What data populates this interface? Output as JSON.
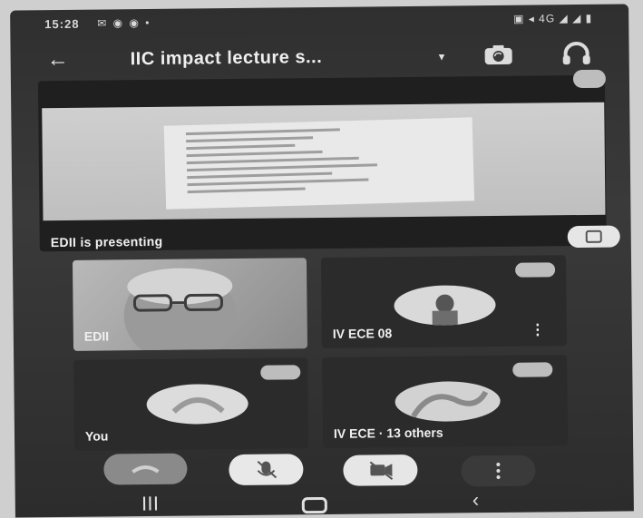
{
  "status_bar": {
    "time": "15:28",
    "left_icons": "✉ ◉ ◉ •",
    "right_icons": "▣ ◂ 4G ◢ ◢ ▮"
  },
  "top_bar": {
    "title": "IIC impact lecture s...",
    "chevron": "▾"
  },
  "presentation": {
    "presenting_label": "EDII is presenting"
  },
  "participants": [
    {
      "name": "EDII"
    },
    {
      "name": "IV ECE 08"
    },
    {
      "name": "You"
    },
    {
      "name": "IV ECE · 13 others"
    }
  ],
  "colors": {
    "frame": "#333333",
    "tile": "#2b2b2b",
    "text": "#f0f0f0",
    "pill": "#bdbdbd"
  },
  "icons": {
    "back": "arrow-left-icon",
    "camera_switch": "camera-switch-icon",
    "audio": "headphones-icon",
    "end_call": "phone-hangup-icon",
    "mic": "mic-off-icon",
    "camera": "camera-off-icon",
    "more": "more-vert-icon"
  }
}
